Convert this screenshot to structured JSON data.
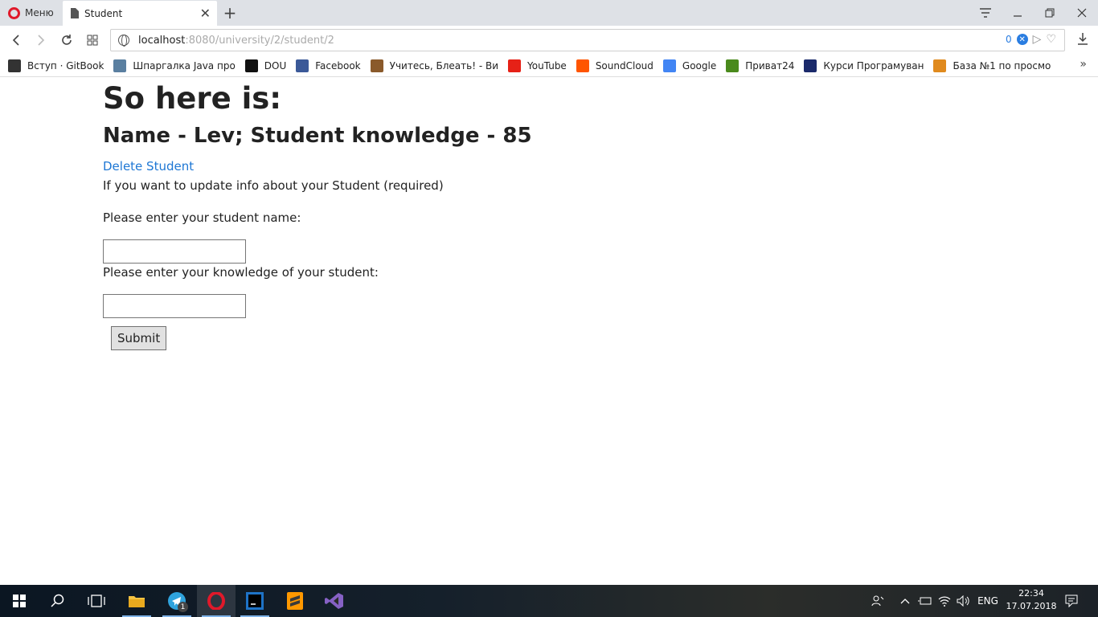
{
  "browser": {
    "menu_label": "Меню",
    "tab_title": "Student",
    "address": {
      "host": "localhost",
      "path": ":8080/university/2/student/2",
      "badge_count": "0"
    },
    "bookmarks": [
      {
        "label": "Вступ · GitBook",
        "icon": "book-icon",
        "color": "#333333"
      },
      {
        "label": "Шпаргалка Java про",
        "icon": "h-icon",
        "color": "#5a7fa0"
      },
      {
        "label": "DOU",
        "icon": "dou-icon",
        "color": "#111111"
      },
      {
        "label": "Facebook",
        "icon": "facebook-icon",
        "color": "#3b5998"
      },
      {
        "label": "Учитесь, Блеать! - Ви",
        "icon": "owl-icon",
        "color": "#8a5a2b"
      },
      {
        "label": "YouTube",
        "icon": "youtube-icon",
        "color": "#e62117"
      },
      {
        "label": "SoundCloud",
        "icon": "soundcloud-icon",
        "color": "#ff5500"
      },
      {
        "label": "Google",
        "icon": "google-icon",
        "color": "#4285f4"
      },
      {
        "label": "Приват24",
        "icon": "privat24-icon",
        "color": "#4a8a1c"
      },
      {
        "label": "Курси Програмуван",
        "icon": "courses-icon",
        "color": "#1b2a6b"
      },
      {
        "label": "База №1 по просмо",
        "icon": "tiger-icon",
        "color": "#e08a1e"
      }
    ]
  },
  "page": {
    "title": "So here is:",
    "subtitle": "Name - Lev; Student knowledge - 85",
    "delete_link": "Delete Student",
    "update_text": "If you want to update info about your Student (required)",
    "name_label": "Please enter your student name:",
    "knowledge_label": "Please enter your knowledge of your student:",
    "submit_label": "Submit"
  },
  "taskbar": {
    "telegram_badge": "1",
    "language": "ENG",
    "time": "22:34",
    "date": "17.07.2018"
  },
  "colors": {
    "link": "#1e77d4",
    "opera_red": "#e0192a",
    "accent": "#2a7de1"
  }
}
